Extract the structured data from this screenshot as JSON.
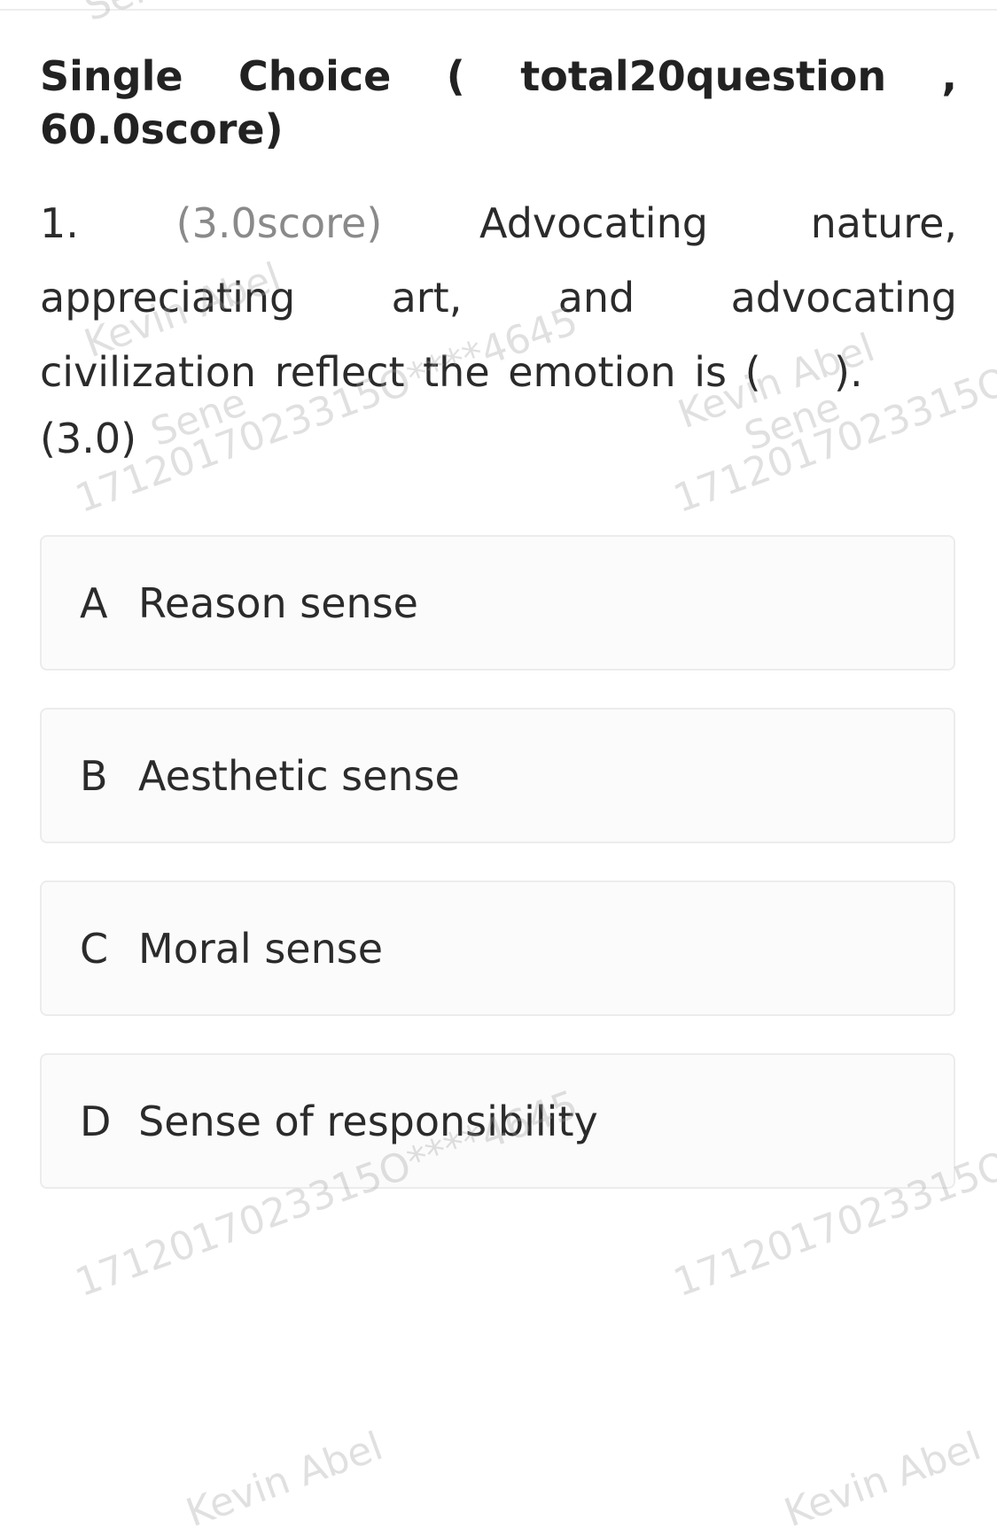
{
  "section": {
    "title": "Single Choice ( total20question , 60.0score)"
  },
  "question": {
    "number": "1.",
    "score": "(3.0score)",
    "text": "Advocating nature, appreciating art, and advocating civilization reflect the emotion is (    ).",
    "points": "(3.0)"
  },
  "options": [
    {
      "letter": "A",
      "text": "Reason sense"
    },
    {
      "letter": "B",
      "text": "Aesthetic sense"
    },
    {
      "letter": "C",
      "text": "Moral sense"
    },
    {
      "letter": "D",
      "text": "Sense of responsibility"
    }
  ],
  "watermark": {
    "name": "Kevin Abel",
    "org": "Sene",
    "id": "1712017023315O****4645"
  }
}
